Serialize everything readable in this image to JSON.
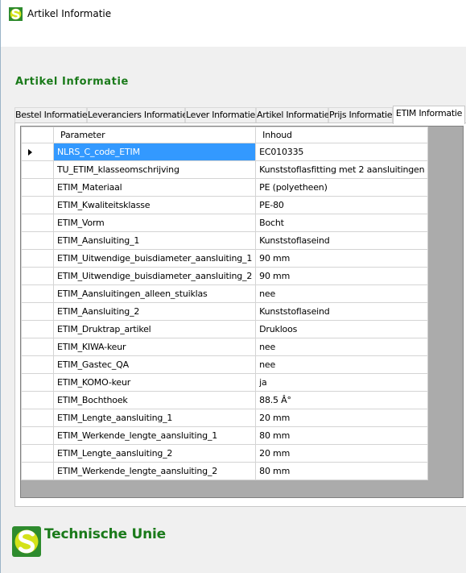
{
  "window": {
    "title": "Artikel Informatie",
    "icon": "technische-unie-logo-icon"
  },
  "page": {
    "heading": "Artikel Informatie"
  },
  "tabs": [
    {
      "label": "Bestel Informatie",
      "active": false
    },
    {
      "label": "Leveranciers Informatie",
      "active": false
    },
    {
      "label": "Lever Informatie",
      "active": false
    },
    {
      "label": "Artikel Informatie",
      "active": false
    },
    {
      "label": "Prijs Informatie",
      "active": false
    },
    {
      "label": "ETIM Informatie",
      "active": true
    }
  ],
  "grid": {
    "columns": [
      "Parameter",
      "Inhoud"
    ],
    "selected_row": 0,
    "rows": [
      [
        "NLRS_C_code_ETIM",
        "EC010335"
      ],
      [
        "TU_ETIM_klasseomschrijving",
        "Kunststoflasfitting met 2 aansluitingen"
      ],
      [
        "ETIM_Materiaal",
        "PE (polyetheen)"
      ],
      [
        "ETIM_Kwaliteitsklasse",
        "PE-80"
      ],
      [
        "ETIM_Vorm",
        "Bocht"
      ],
      [
        "ETIM_Aansluiting_1",
        "Kunststoflaseind"
      ],
      [
        "ETIM_Uitwendige_buisdiameter_aansluiting_1",
        "90 mm"
      ],
      [
        "ETIM_Uitwendige_buisdiameter_aansluiting_2",
        "90 mm"
      ],
      [
        "ETIM_Aansluitingen_alleen_stuiklas",
        "nee"
      ],
      [
        "ETIM_Aansluiting_2",
        "Kunststoflaseind"
      ],
      [
        "ETIM_Druktrap_artikel",
        "Drukloos"
      ],
      [
        "ETIM_KIWA-keur",
        "nee"
      ],
      [
        "ETIM_Gastec_QA",
        "nee"
      ],
      [
        "ETIM_KOMO-keur",
        "ja"
      ],
      [
        "ETIM_Bochthoek",
        "88.5 Â°"
      ],
      [
        "ETIM_Lengte_aansluiting_1",
        "20 mm"
      ],
      [
        "ETIM_Werkende_lengte_aansluiting_1",
        "80 mm"
      ],
      [
        "ETIM_Lengte_aansluiting_2",
        "20 mm"
      ],
      [
        "ETIM_Werkende_lengte_aansluiting_2",
        "80 mm"
      ]
    ]
  },
  "footer": {
    "brand": "Technische Unie",
    "logo_icon": "technische-unie-logo-icon"
  },
  "colors": {
    "brand_green": "#1a7a1a",
    "selection_blue": "#3399ff",
    "grid_background": "#ababab"
  }
}
